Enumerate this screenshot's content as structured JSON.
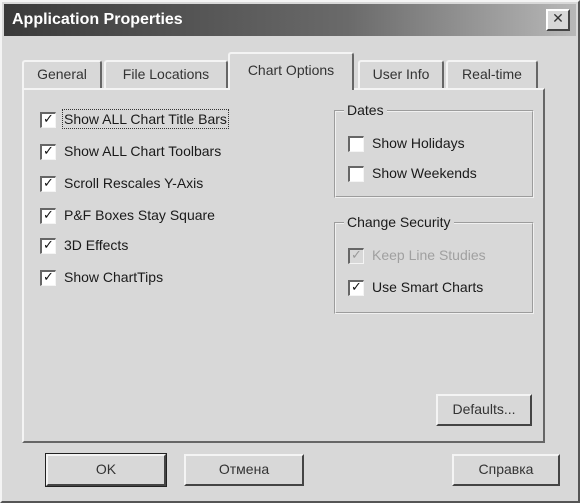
{
  "window": {
    "title": "Application Properties",
    "close_glyph": "✕"
  },
  "tabs": [
    {
      "label": "General",
      "active": false
    },
    {
      "label": "File Locations",
      "active": false
    },
    {
      "label": "Chart Options",
      "active": true
    },
    {
      "label": "User Info",
      "active": false
    },
    {
      "label": "Real-time",
      "active": false
    }
  ],
  "chart_options": {
    "checkboxes": [
      {
        "label": "Show ALL Chart Title Bars",
        "checked": true
      },
      {
        "label": "Show ALL Chart Toolbars",
        "checked": true
      },
      {
        "label": "Scroll Rescales Y-Axis",
        "checked": true
      },
      {
        "label": "P&F Boxes Stay Square",
        "checked": true
      },
      {
        "label": "3D Effects",
        "checked": true
      },
      {
        "label": "Show ChartTips",
        "checked": true
      }
    ]
  },
  "dates": {
    "title": "Dates",
    "items": [
      {
        "label": "Show Holidays",
        "checked": false
      },
      {
        "label": "Show Weekends",
        "checked": false
      }
    ]
  },
  "change_security": {
    "title": "Change Security",
    "items": [
      {
        "label": "Keep Line Studies",
        "checked": true,
        "disabled": true
      },
      {
        "label": "Use Smart Charts",
        "checked": true,
        "disabled": false
      }
    ]
  },
  "buttons": {
    "defaults": "Defaults...",
    "ok": "OK",
    "cancel": "Отмена",
    "help": "Справка"
  },
  "check_glyph": "✓"
}
